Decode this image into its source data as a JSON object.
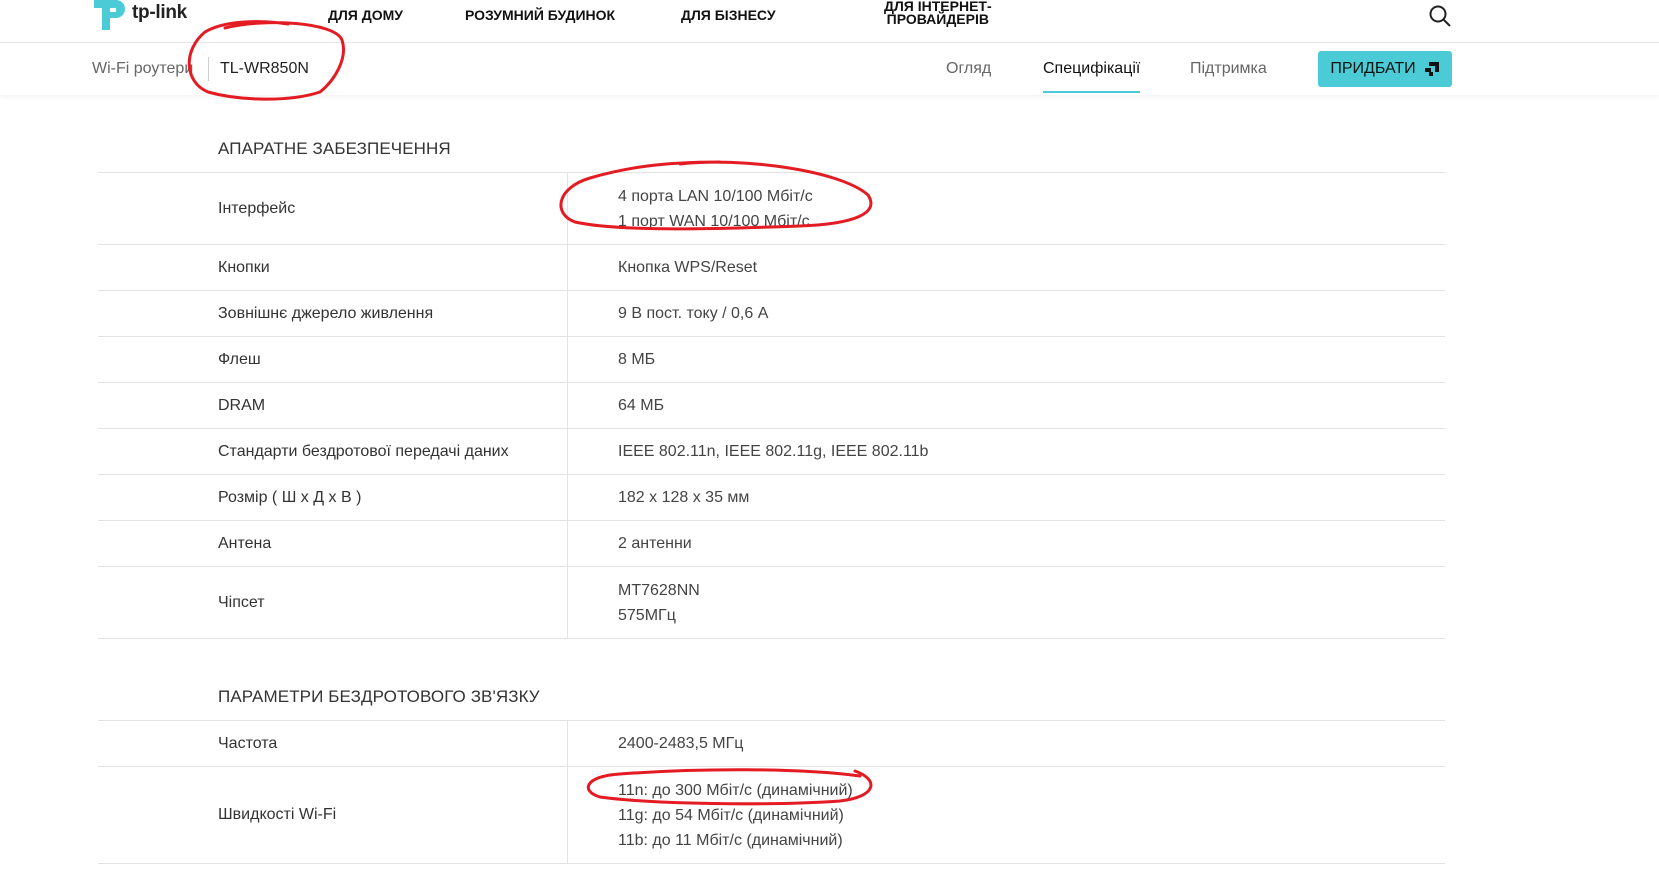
{
  "brand": {
    "name": "tp-link",
    "accent_color": "#4acbd6",
    "annotation_color": "#e31b23"
  },
  "topnav": {
    "items": [
      "ДЛЯ ДОМУ",
      "РОЗУМНИЙ БУДИНОК",
      "ДЛЯ БІЗНЕСУ"
    ],
    "isp_line1": "ДЛЯ ІНТЕРНЕТ-",
    "isp_line2": "ПРОВАЙДЕРІВ",
    "search_icon": "search-icon"
  },
  "subnav": {
    "category": "Wi-Fi роутери",
    "model": "TL-WR850N",
    "tabs": [
      "Огляд",
      "Специфікації",
      "Підтримка"
    ],
    "active_tab": "Специфікації",
    "buy_label": "ПРИДБАТИ"
  },
  "hardware": {
    "title": "АПАРАТНЕ ЗАБЕЗПЕЧЕННЯ",
    "rows": [
      {
        "label": "Інтерфейс",
        "lines": [
          "4 порта LAN 10/100 Мбіт/с",
          "1 порт WAN 10/100 Мбіт/с"
        ]
      },
      {
        "label": "Кнопки",
        "lines": [
          "Кнопка WPS/Reset"
        ]
      },
      {
        "label": "Зовнішнє джерело живлення",
        "lines": [
          "9 В пост. току / 0,6 А"
        ]
      },
      {
        "label": "Флеш",
        "lines": [
          "8 МБ"
        ]
      },
      {
        "label": "DRAM",
        "lines": [
          "64 МБ"
        ]
      },
      {
        "label": "Стандарти бездротової передачі даних",
        "lines": [
          "IEEE 802.11n, IEEE 802.11g, IEEE 802.11b"
        ]
      },
      {
        "label": "Розмір ( Ш x Д x В )",
        "lines": [
          "182 x 128 x 35 мм"
        ]
      },
      {
        "label": "Антена",
        "lines": [
          "2 антенни"
        ]
      },
      {
        "label": "Чіпсет",
        "lines": [
          "MT7628NN",
          "575МГц"
        ]
      }
    ]
  },
  "wireless": {
    "title": "ПАРАМЕТРИ БЕЗДРОТОВОГО ЗВ'ЯЗКУ",
    "rows": [
      {
        "label": "Частота",
        "lines": [
          "2400-2483,5 МГц"
        ]
      },
      {
        "label": "Швидкості Wi-Fi",
        "lines": [
          "11n: до 300 Мбіт/с (динамічний)",
          "11g: до 54 Мбіт/с (динамічний)",
          "11b: до 11 Мбіт/с (динамічний)"
        ]
      }
    ]
  }
}
